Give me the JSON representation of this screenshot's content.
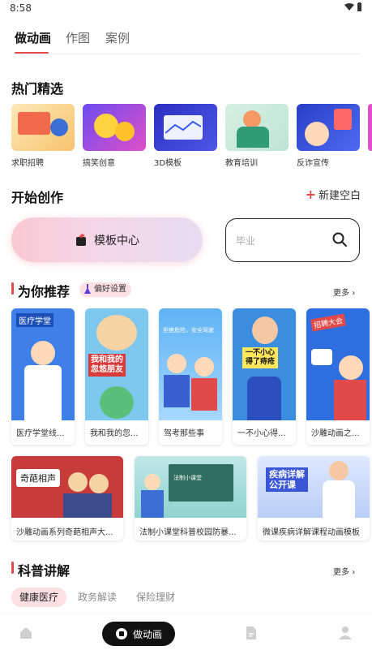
{
  "status": {
    "time": "8:58"
  },
  "tabs": [
    {
      "label": "做动画"
    },
    {
      "label": "作图"
    },
    {
      "label": "案例"
    }
  ],
  "hot": {
    "title": "热门精选",
    "items": [
      {
        "label": "求职招聘"
      },
      {
        "label": "搞笑创意"
      },
      {
        "label": "3D模板"
      },
      {
        "label": "教育培训"
      },
      {
        "label": "反诈宣传"
      }
    ]
  },
  "create": {
    "title": "开始创作",
    "new_blank": "新建空白",
    "template_center": "模板中心",
    "search_placeholder": "毕业"
  },
  "recommend": {
    "title": "为你推荐",
    "preference": "偏好设置",
    "more": "更多",
    "cards": [
      {
        "label": "医疗学堂线...",
        "thumb_text": "医疗学堂"
      },
      {
        "label": "我和我的忽...",
        "thumb_text": "我和我的\n忽悠朋友"
      },
      {
        "label": "驾考那些事",
        "thumb_text": "拒绝危险，安全驾驶"
      },
      {
        "label": "一不小心得...",
        "thumb_text": "一不小心\n得了痔疮"
      },
      {
        "label": "沙雕动画之...",
        "thumb_text": "招聘大会"
      }
    ],
    "wide_cards": [
      {
        "label": "沙雕动画系列奇葩相声大...",
        "thumb_text": "奇葩相声"
      },
      {
        "label": "法制小课堂科普校园防暴...",
        "thumb_text": "法制小课堂"
      },
      {
        "label": "微课疾病详解课程动画模板",
        "thumb_text": "疾病详解\n公开课"
      }
    ]
  },
  "science": {
    "title": "科普讲解",
    "more": "更多",
    "chips": [
      {
        "label": "健康医疗"
      },
      {
        "label": "政务解读"
      },
      {
        "label": "保险理财"
      }
    ]
  },
  "bottom_nav": {
    "active_label": "做动画"
  }
}
